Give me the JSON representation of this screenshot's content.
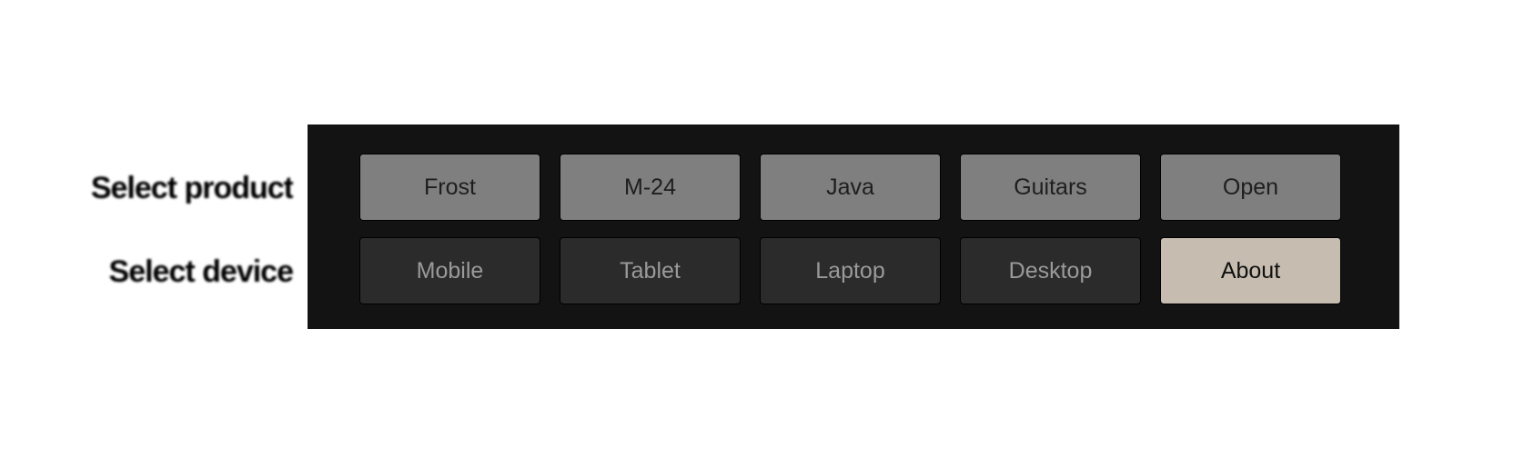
{
  "labels": {
    "row1": "Select product",
    "row2": "Select device"
  },
  "products": [
    "Frost",
    "M-24",
    "Java",
    "Guitars",
    "Open"
  ],
  "devices": [
    "Mobile",
    "Tablet",
    "Laptop",
    "Desktop"
  ],
  "about_label": "About",
  "colors": {
    "panel": "#131313",
    "product_button": "#7f7f7f",
    "device_button": "#2b2b2b",
    "about_button": "#c6bdb0"
  }
}
